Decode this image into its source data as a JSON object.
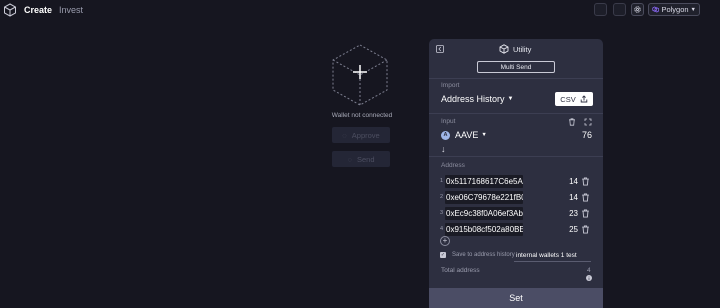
{
  "nav": {
    "create": "Create",
    "invest": "Invest",
    "network": "Polygon"
  },
  "wallet": {
    "status": "Wallet not connected",
    "approve_label": "Approve",
    "send_label": "Send"
  },
  "utility": {
    "title": "Utility",
    "mode_button": "Multi Send",
    "import_label": "Import",
    "history_select": "Address History",
    "csv_button": "CSV",
    "input_label": "Input",
    "token": {
      "name": "AAVE",
      "amount": "76"
    },
    "address_label": "Address",
    "addresses": [
      {
        "index": "1",
        "address": "0x5117168617C6e5A6",
        "amount": "14"
      },
      {
        "index": "2",
        "address": "0xe06C79678e221fB0D",
        "amount": "14"
      },
      {
        "index": "3",
        "address": "0xEc9c38f0A06ef3Ab2",
        "amount": "23"
      },
      {
        "index": "4",
        "address": "0x915b08cf502a80BEb",
        "amount": "25"
      }
    ],
    "save_label": "Save to address history",
    "history_name": "internal wallets 1 test",
    "total_label": "Total address",
    "total_value": "4",
    "set_button": "Set"
  },
  "colors": {
    "background": "#161620",
    "panel": "#2d2f40",
    "set_button": "#4b4d65",
    "network_icon": "#8f6bff"
  }
}
